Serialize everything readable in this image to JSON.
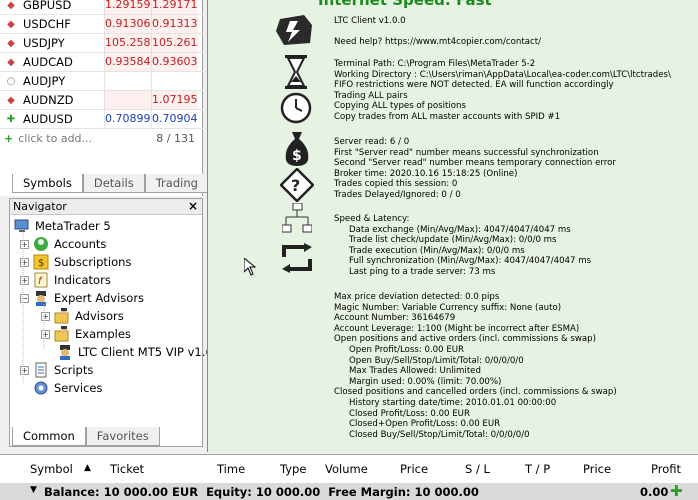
{
  "market_watch": {
    "rows": [
      {
        "symbol": "GBPUSD",
        "bid": "1.29159",
        "ask": "1.29171",
        "dir": "down"
      },
      {
        "symbol": "USDCHF",
        "bid": "0.91306",
        "ask": "0.91313",
        "dir": "down"
      },
      {
        "symbol": "USDJPY",
        "bid": "105.258",
        "ask": "105.261",
        "dir": "down"
      },
      {
        "symbol": "AUDCAD",
        "bid": "0.93584",
        "ask": "0.93603",
        "dir": "down"
      },
      {
        "symbol": "AUDJPY",
        "bid": "",
        "ask": "",
        "dir": "none"
      },
      {
        "symbol": "AUDNZD",
        "bid": "",
        "ask": "1.07195",
        "dir": "down"
      },
      {
        "symbol": "AUDUSD",
        "bid": "0.70899",
        "ask": "0.70904",
        "dir": "up"
      }
    ],
    "add_label": "click to add...",
    "count": "8 / 131",
    "tabs": [
      "Symbols",
      "Details",
      "Trading"
    ]
  },
  "navigator": {
    "title": "Navigator",
    "close": "×",
    "items": [
      "MetaTrader 5",
      "Accounts",
      "Subscriptions",
      "Indicators",
      "Expert Advisors",
      "Advisors",
      "Examples",
      "LTC Client MT5 VIP v1.(",
      "Scripts",
      "Services"
    ],
    "tabs": [
      "Common",
      "Favorites"
    ]
  },
  "chart": {
    "banner": "Internet Speed: Fast",
    "sections": [
      [
        "LTC Client v1.0.0",
        "",
        "Need help? https://www.mt4copier.com/contact/"
      ],
      [
        "Terminal Path: C:\\Program Files\\MetaTrader 5-2",
        "Working Directory : C:\\Users\\riman\\AppData\\Local\\ea-coder.com\\LTC\\ltctrades\\",
        "FIFO restrictions were NOT detected. EA will function accordingly",
        "Trading ALL pairs",
        "Copying ALL types of positions",
        "Copy trades from ALL master accounts with SPID #1"
      ],
      [
        "Server read: 6 / 0",
        "First \"Server read\" number means successful synchronization",
        "Second \"Server read\" number means temporary connection error",
        "Broker time: 2020.10.16 15:18:25 (Online)",
        "Trades copied this session: 0",
        "Trades Delayed/Ignored: 0 / 0"
      ],
      [
        "Speed & Latency:",
        ">Data exchange (Min/Avg/Max): 4047/4047/4047 ms",
        ">Trade list check/update (Min/Avg/Max): 0/0/0 ms",
        ">Trade execution (Min/Avg/Max): 0/0/0 ms",
        ">Full synchronization (Min/Avg/Max): 4047/4047/4047 ms",
        ">Last ping to a trade server: 73 ms"
      ],
      [
        "Max price deviation detected: 0.0 pips",
        "Magic Number: Variable     Currency suffix: None (auto)",
        "Account Number: 36164679",
        "Account Leverage: 1:100 (Might be incorrect after ESMA)",
        "Open positions and active orders (incl. commissions & swap)",
        ">Open Profit/Loss: 0.00 EUR",
        ">Open Buy/Sell/Stop/Limit/Total: 0/0/0/0/0",
        ">Max Trades Allowed: Unlimited",
        ">Margin used: 0.00% (limit: 70.00%)",
        "Closed positions and cancelled orders (incl. commissions & swap)",
        ">History starting date/time: 2010.01.01 00:00:00",
        ">Closed Profit/Loss: 0.00 EUR",
        ">Closed+Open Profit/Loss: 0.00 EUR",
        ">Closed Buy/Sell/Stop/Limit/Total: 0/0/0/0/0"
      ]
    ]
  },
  "terminal": {
    "columns": [
      "Symbol",
      "Ticket",
      "Time",
      "Type",
      "Volume",
      "Price",
      "S / L",
      "T / P",
      "Price",
      "Profit"
    ],
    "balance_text": "Balance: 10 000.00 EUR  Equity: 10 000.00  Free Margin: 10 000.00",
    "profit_total": "0.00"
  }
}
